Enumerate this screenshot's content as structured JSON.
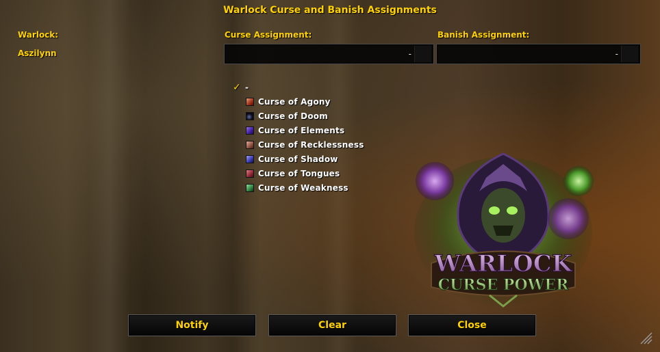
{
  "window": {
    "title": "Warlock Curse and Banish Assignments"
  },
  "columns": {
    "warlock_header": "Warlock:",
    "curse_header": "Curse Assignment:",
    "banish_header": "Banish Assignment:"
  },
  "rows": [
    {
      "warlock": "Aszilynn",
      "curse_value": "-",
      "banish_value": "-"
    }
  ],
  "curse_menu": {
    "items": [
      {
        "label": "-",
        "checked": true,
        "icon": "checkmark-icon",
        "color": "#ffd200"
      },
      {
        "label": "Curse of Agony",
        "icon": "curse-of-agony-icon",
        "color": "#b04020"
      },
      {
        "label": "Curse of Doom",
        "icon": "curse-of-doom-icon",
        "color": "#101020"
      },
      {
        "label": "Curse of Elements",
        "icon": "curse-of-elements-icon",
        "color": "#5030a0"
      },
      {
        "label": "Curse of Recklessness",
        "icon": "curse-of-recklessness-icon",
        "color": "#a06050"
      },
      {
        "label": "Curse of Shadow",
        "icon": "curse-of-shadow-icon",
        "color": "#4040b0"
      },
      {
        "label": "Curse of Tongues",
        "icon": "curse-of-tongues-icon",
        "color": "#a03040"
      },
      {
        "label": "Curse of Weakness",
        "icon": "curse-of-weakness-icon",
        "color": "#308040"
      }
    ]
  },
  "emblem": {
    "line1": "WARLOCK",
    "line2": "CURSE POWER"
  },
  "buttons": {
    "notify": "Notify",
    "clear": "Clear",
    "close": "Close"
  },
  "theme": {
    "accent": "#ffd200",
    "text": "#ffffff"
  }
}
